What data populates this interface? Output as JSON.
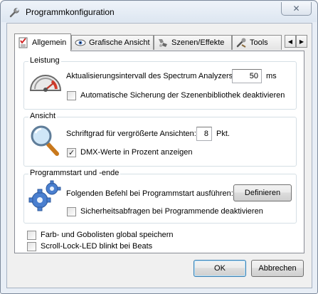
{
  "window": {
    "title": "Programmkonfiguration",
    "close_glyph": "✕"
  },
  "tabs": [
    {
      "label": "Allgemein",
      "icon": "checklist-icon",
      "active": true
    },
    {
      "label": "Grafische Ansicht",
      "icon": "eye-icon",
      "active": false
    },
    {
      "label": "Szenen/Effekte",
      "icon": "scenes-icon",
      "active": false
    },
    {
      "label": "Tools",
      "icon": "tools-icon",
      "active": false
    }
  ],
  "tab_scroll": {
    "left": "◀",
    "right": "▶"
  },
  "leistung": {
    "title": "Leistung",
    "interval_label": "Aktualisierungsintervall des Spectrum Analyzers:",
    "interval_value": "50",
    "interval_unit": "ms",
    "autosave_label": "Automatische Sicherung der Szenenbibliothek deaktivieren",
    "autosave_checked": false
  },
  "ansicht": {
    "title": "Ansicht",
    "fontsize_label": "Schriftgrad für vergrößerte Ansichten:",
    "fontsize_value": "8",
    "fontsize_unit": "Pkt.",
    "dmx_label": "DMX-Werte in Prozent anzeigen",
    "dmx_checked": true
  },
  "programmstart": {
    "title": "Programmstart und -ende",
    "command_label": "Folgenden Befehl bei Programmstart ausführen:",
    "define_button": "Definieren",
    "safety_label": "Sicherheitsabfragen bei Programmende deaktivieren",
    "safety_checked": false
  },
  "global": {
    "save_colors_label": "Farb- und Gobolisten global speichern",
    "save_colors_checked": false,
    "scroll_lock_label": "Scroll-Lock-LED blinkt bei Beats",
    "scroll_lock_checked": false
  },
  "buttons": {
    "ok": "OK",
    "cancel": "Abbrechen"
  },
  "colors": {
    "accent": "#3c7fb1",
    "gauge_red": "#d23b2a",
    "gear_blue": "#4a7fcf"
  }
}
